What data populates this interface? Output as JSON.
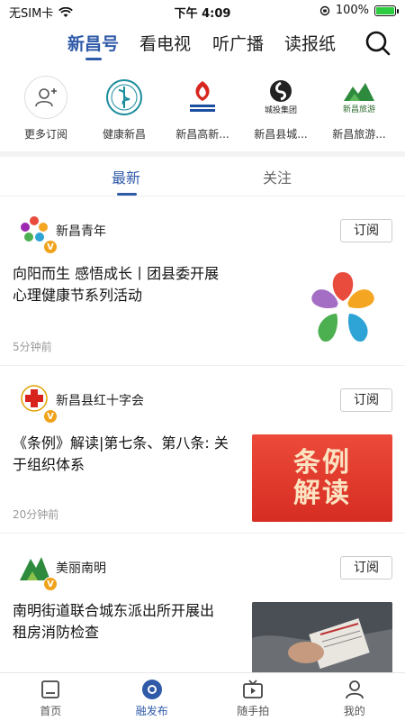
{
  "status_bar": {
    "carrier": "无SIM卡",
    "time": "下午 4:09",
    "battery": "100%"
  },
  "top_tabs": [
    {
      "label": "新昌号"
    },
    {
      "label": "看电视"
    },
    {
      "label": "听广播"
    },
    {
      "label": "读报纸"
    }
  ],
  "channels": [
    {
      "label": "更多订阅",
      "icon": "add-user-icon"
    },
    {
      "label": "健康新昌",
      "icon": "health-logo"
    },
    {
      "label": "新昌高新...",
      "icon": "hitech-logo"
    },
    {
      "label": "新昌县城...",
      "icon": "urban-investment-logo",
      "logo_text": "城投集团"
    },
    {
      "label": "新昌旅游...",
      "icon": "tourism-logo",
      "logo_text": "新昌旅游"
    }
  ],
  "sub_tabs": [
    {
      "label": "最新"
    },
    {
      "label": "关注"
    }
  ],
  "feed": [
    {
      "source": "新昌青年",
      "subscribe": "订阅",
      "title_line1": "向阳而生  感悟成长丨团县委开展",
      "title_line2": "心理健康节系列活动",
      "time": "5分钟前"
    },
    {
      "source": "新昌县红十字会",
      "subscribe": "订阅",
      "title_line1": "《条例》解读|第七条、第八条: 关",
      "title_line2": "于组织体系",
      "time": "20分钟前",
      "thumb_text_1": "条例",
      "thumb_text_2": "解读"
    },
    {
      "source": "美丽南明",
      "subscribe": "订阅",
      "title_line1": "南明街道联合城东派出所开展出",
      "title_line2": "租房消防检查"
    }
  ],
  "bottom_nav": [
    {
      "label": "首页"
    },
    {
      "label": "融发布"
    },
    {
      "label": "随手拍"
    },
    {
      "label": "我的"
    }
  ],
  "colors": {
    "accent": "#2f5aa8",
    "badge": "#f0a21a"
  }
}
